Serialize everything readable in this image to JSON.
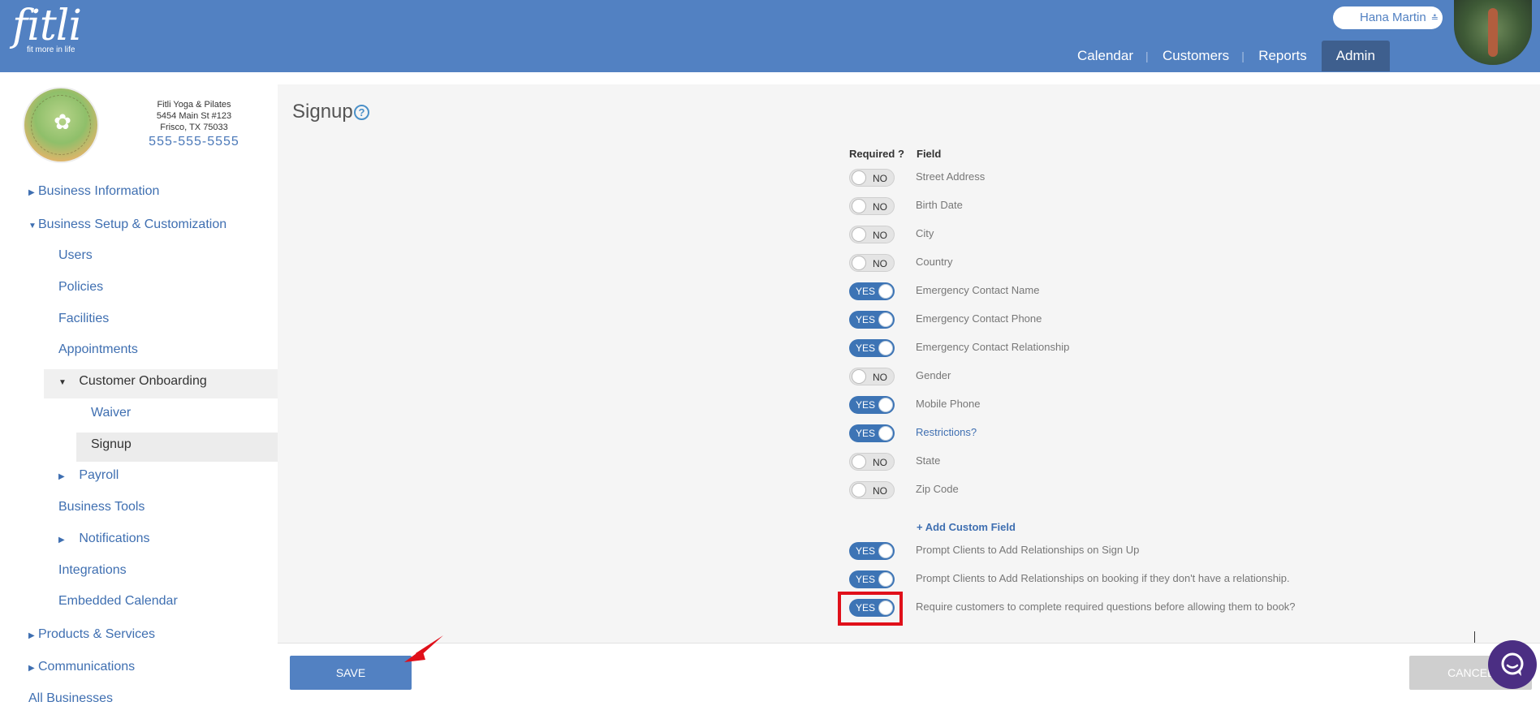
{
  "header": {
    "logo_text": "fitli",
    "logo_tagline": "fit more in life",
    "user_name": "Hana Martin",
    "nav": [
      "Calendar",
      "Customers",
      "Reports",
      "Admin"
    ],
    "active_nav": "Admin"
  },
  "business": {
    "name": "Fitli Yoga & Pilates",
    "address1": "5454 Main St #123",
    "address2": "Frisco, TX 75033",
    "phone": "555-555-5555",
    "logo_text": "FITLI YOGA & PILATES"
  },
  "sidebar": {
    "items": [
      {
        "label": "Business Information"
      },
      {
        "label": "Business Setup & Customization"
      },
      {
        "label": "Users"
      },
      {
        "label": "Policies"
      },
      {
        "label": "Facilities"
      },
      {
        "label": "Appointments"
      },
      {
        "label": "Customer Onboarding"
      },
      {
        "label": "Waiver"
      },
      {
        "label": "Signup"
      },
      {
        "label": "Payroll"
      },
      {
        "label": "Business Tools"
      },
      {
        "label": "Notifications"
      },
      {
        "label": "Integrations"
      },
      {
        "label": "Embedded Calendar"
      },
      {
        "label": "Products & Services"
      },
      {
        "label": "Communications"
      },
      {
        "label": "All Businesses"
      }
    ]
  },
  "page": {
    "title": "Signup",
    "col_required": "Required ?",
    "col_field": "Field",
    "fields": [
      {
        "state": "NO",
        "label": "Street Address"
      },
      {
        "state": "NO",
        "label": "Birth Date"
      },
      {
        "state": "NO",
        "label": "City"
      },
      {
        "state": "NO",
        "label": "Country"
      },
      {
        "state": "YES",
        "label": "Emergency Contact Name"
      },
      {
        "state": "YES",
        "label": "Emergency Contact Phone"
      },
      {
        "state": "YES",
        "label": "Emergency Contact Relationship"
      },
      {
        "state": "NO",
        "label": "Gender"
      },
      {
        "state": "YES",
        "label": "Mobile Phone"
      },
      {
        "state": "YES",
        "label": "Restrictions?"
      },
      {
        "state": "NO",
        "label": "State"
      },
      {
        "state": "NO",
        "label": "Zip Code"
      }
    ],
    "add_custom_field": "+ Add Custom Field",
    "options": [
      {
        "state": "YES",
        "label": "Prompt Clients to Add Relationships on Sign Up"
      },
      {
        "state": "YES",
        "label": "Prompt Clients to Add Relationships on booking if they don't have a relationship."
      },
      {
        "state": "YES",
        "label": "Require customers to complete required questions before allowing them to book?"
      }
    ],
    "save_label": "SAVE",
    "cancel_label": "CANCEL"
  },
  "colors": {
    "header_bg": "#5281c2",
    "accent": "#3d74b5",
    "highlight": "#e0101a"
  }
}
